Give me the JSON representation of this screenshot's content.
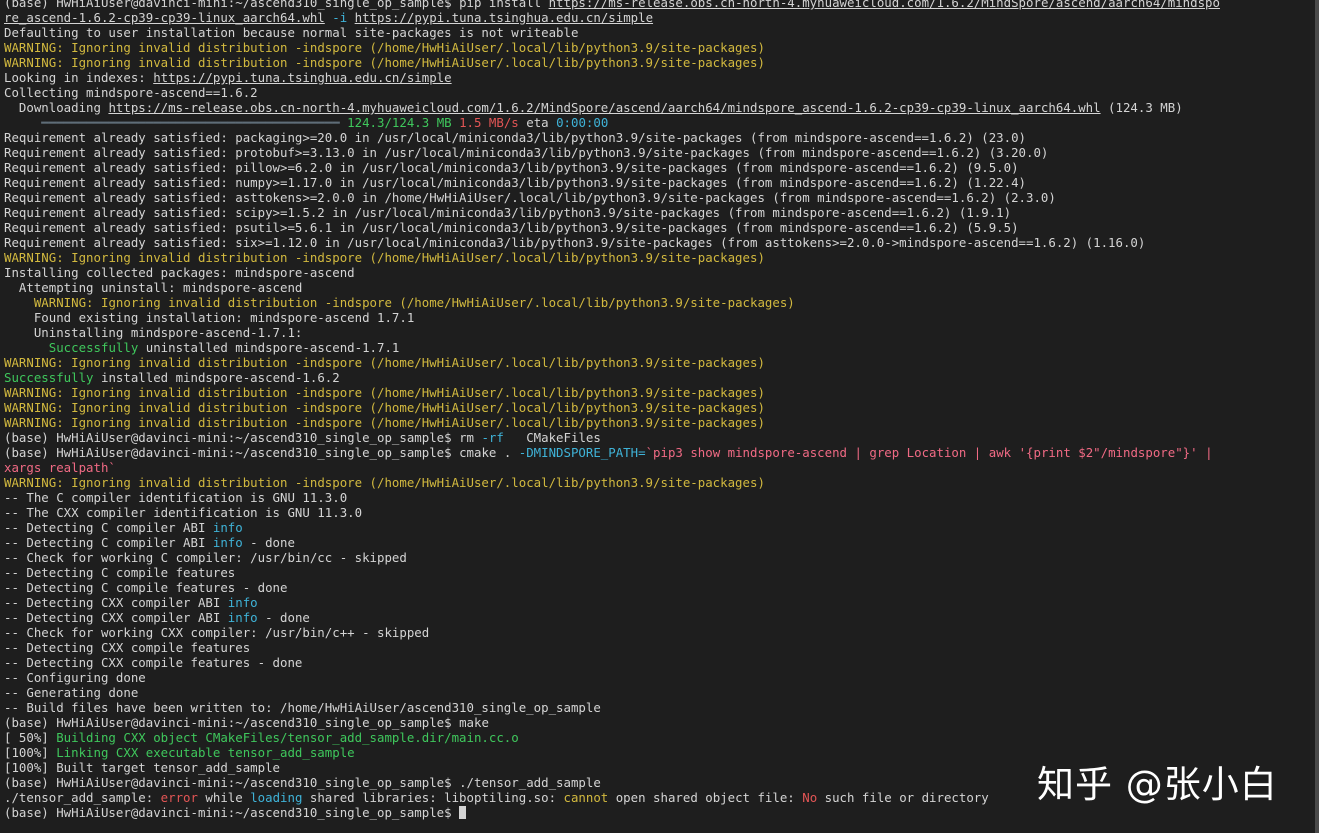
{
  "prompt": "(base) HwHiAiUser@davinci-mini:~/ascend310_single_op_sample$ ",
  "warning_prefix": "WARNING: ",
  "warning_text": "Ignoring invalid distribution -indspore (/home/HwHiAiUser/.local/lib/python3.9/site-packages)",
  "pip": {
    "cmd": "pip install ",
    "url_line1": "https://ms-release.obs.cn-north-4.myhuaweicloud.com/1.6.2/MindSpore/ascend/aarch64/mindspo",
    "url_line2": "re_ascend-1.6.2-cp39-cp39-linux_aarch64.whl",
    "flag": "-i",
    "index_url": "https://pypi.tuna.tsinghua.edu.cn/simple",
    "defaulting": "Defaulting to user installation because normal site-packages is not writeable",
    "looking": "Looking in indexes: ",
    "collecting": "Collecting mindspore-ascend==1.6.2",
    "downloading": "  Downloading ",
    "download_url": "https://ms-release.obs.cn-north-4.myhuaweicloud.com/1.6.2/MindSpore/ascend/aarch64/mindspore_ascend-1.6.2-cp39-cp39-linux_aarch64.whl",
    "download_size": " (124.3 MB)",
    "progress_size": "124.3/124.3 MB",
    "progress_speed": "1.5 MB/s",
    "progress_eta_label": "eta",
    "progress_eta": "0:00:00"
  },
  "requirements": [
    "Requirement already satisfied: packaging>=20.0 in /usr/local/miniconda3/lib/python3.9/site-packages (from mindspore-ascend==1.6.2) (23.0)",
    "Requirement already satisfied: protobuf>=3.13.0 in /usr/local/miniconda3/lib/python3.9/site-packages (from mindspore-ascend==1.6.2) (3.20.0)",
    "Requirement already satisfied: pillow>=6.2.0 in /usr/local/miniconda3/lib/python3.9/site-packages (from mindspore-ascend==1.6.2) (9.5.0)",
    "Requirement already satisfied: numpy>=1.17.0 in /usr/local/miniconda3/lib/python3.9/site-packages (from mindspore-ascend==1.6.2) (1.22.4)",
    "Requirement already satisfied: asttokens>=2.0.0 in /home/HwHiAiUser/.local/lib/python3.9/site-packages (from mindspore-ascend==1.6.2) (2.3.0)",
    "Requirement already satisfied: scipy>=1.5.2 in /usr/local/miniconda3/lib/python3.9/site-packages (from mindspore-ascend==1.6.2) (1.9.1)",
    "Requirement already satisfied: psutil>=5.6.1 in /usr/local/miniconda3/lib/python3.9/site-packages (from mindspore-ascend==1.6.2) (5.9.5)",
    "Requirement already satisfied: six>=1.12.0 in /usr/local/miniconda3/lib/python3.9/site-packages (from asttokens>=2.0.0->mindspore-ascend==1.6.2) (1.16.0)"
  ],
  "install": {
    "collected": "Installing collected packages: mindspore-ascend",
    "attempting": "  Attempting uninstall: mindspore-ascend",
    "found": "    Found existing installation: mindspore-ascend 1.7.1",
    "uninstalling": "    Uninstalling mindspore-ascend-1.7.1:",
    "success_word": "Successfully",
    "uninstalled_rest": " uninstalled mindspore-ascend-1.7.1",
    "installed_rest": " installed mindspore-ascend-1.6.2"
  },
  "rm": {
    "cmd": "rm ",
    "flag": "-rf",
    "arg": "   CMakeFiles"
  },
  "cmake": {
    "cmd": "cmake . ",
    "flag": "-DMINDSPORE_PATH=",
    "sub_line1": "`pip3 show mindspore-ascend | grep Location | awk '{print $2\"/mindspore\"}' |",
    "sub_line2": "xargs realpath`"
  },
  "cmake_output": {
    "c_id": "-- The C compiler identification is GNU 11.3.0",
    "cxx_id": "-- The CXX compiler identification is GNU 11.3.0",
    "detect_c_abi": "-- Detecting C compiler ABI ",
    "info_word": "info",
    "done_suffix": " - done",
    "check_c": "-- Check for working C compiler: /usr/bin/cc - skipped",
    "detect_c_feat": "-- Detecting C compile features",
    "detect_c_feat_done": "-- Detecting C compile features - done",
    "detect_cxx_abi": "-- Detecting CXX compiler ABI ",
    "check_cxx": "-- Check for working CXX compiler: /usr/bin/c++ - skipped",
    "detect_cxx_feat": "-- Detecting CXX compile features",
    "detect_cxx_feat_done": "-- Detecting CXX compile features - done",
    "configuring": "-- Configuring done",
    "generating": "-- Generating done",
    "written": "-- Build files have been written to: /home/HwHiAiUser/ascend310_single_op_sample"
  },
  "make": {
    "cmd": "make",
    "p50": "[ 50%] ",
    "building": "Building CXX object CMakeFiles/tensor_add_sample.dir/main.cc.o",
    "p100": "[100%] ",
    "linking": "Linking CXX executable tensor_add_sample",
    "built": "[100%] Built target tensor_add_sample"
  },
  "run": {
    "cmd": "./tensor_add_sample",
    "err_prefix": "./tensor_add_sample: ",
    "error_word": "error",
    "while": " while ",
    "loading_word": "loading",
    "shared": " shared libraries: liboptiling.so: ",
    "cannot_word": "cannot",
    "open": " open shared object file: ",
    "no_word": "No",
    "tail": " such file or directory"
  },
  "watermark": "知乎 @张小白",
  "colors": {
    "background": "#1e1e1e",
    "text": "#d4d4d4",
    "warning": "#d2b93f",
    "success": "#3fc75c",
    "info": "#3fb3d8",
    "error": "#e25555",
    "substitution": "#f06a84"
  }
}
